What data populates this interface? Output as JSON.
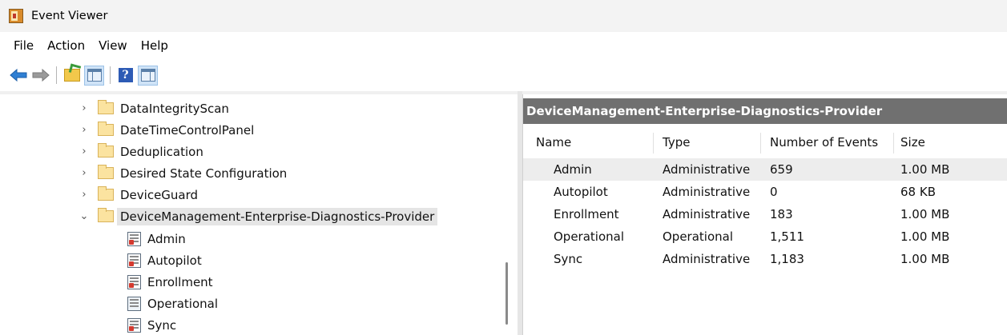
{
  "window": {
    "title": "Event Viewer"
  },
  "menu": [
    "File",
    "Action",
    "View",
    "Help"
  ],
  "toolbar": {
    "buttons": [
      "back-arrow-icon",
      "forward-arrow-icon",
      "up-folder-icon",
      "show-hide-console-tree-icon",
      "help-icon",
      "show-hide-action-pane-icon"
    ],
    "help_glyph": "?"
  },
  "tree": {
    "items": [
      {
        "label": "DataIntegrityScan",
        "expander": "›"
      },
      {
        "label": "DateTimeControlPanel",
        "expander": "›"
      },
      {
        "label": "Deduplication",
        "expander": "›"
      },
      {
        "label": "Desired State Configuration",
        "expander": "›"
      },
      {
        "label": "DeviceGuard",
        "expander": "›"
      },
      {
        "label": "DeviceManagement-Enterprise-Diagnostics-Provider",
        "expander": "⌄"
      }
    ],
    "children": [
      {
        "label": "Admin",
        "icon": "admin-log-icon"
      },
      {
        "label": "Autopilot",
        "icon": "admin-log-icon"
      },
      {
        "label": "Enrollment",
        "icon": "admin-log-icon"
      },
      {
        "label": "Operational",
        "icon": "operational-log-icon"
      },
      {
        "label": "Sync",
        "icon": "admin-log-icon"
      }
    ]
  },
  "details": {
    "header": "DeviceManagement-Enterprise-Diagnostics-Provider",
    "columns": [
      "Name",
      "Type",
      "Number of Events",
      "Size"
    ],
    "rows": [
      {
        "name": "Admin",
        "type": "Administrative",
        "events": "659",
        "size": "1.00 MB"
      },
      {
        "name": "Autopilot",
        "type": "Administrative",
        "events": "0",
        "size": "68 KB"
      },
      {
        "name": "Enrollment",
        "type": "Administrative",
        "events": "183",
        "size": "1.00 MB"
      },
      {
        "name": "Operational",
        "type": "Operational",
        "events": "1,511",
        "size": "1.00 MB"
      },
      {
        "name": "Sync",
        "type": "Administrative",
        "events": "1,183",
        "size": "1.00 MB"
      }
    ]
  },
  "colors": {
    "accent_arrow": "#2f7fd3",
    "header_bg": "#707070",
    "selection": "#e5e5e5"
  }
}
